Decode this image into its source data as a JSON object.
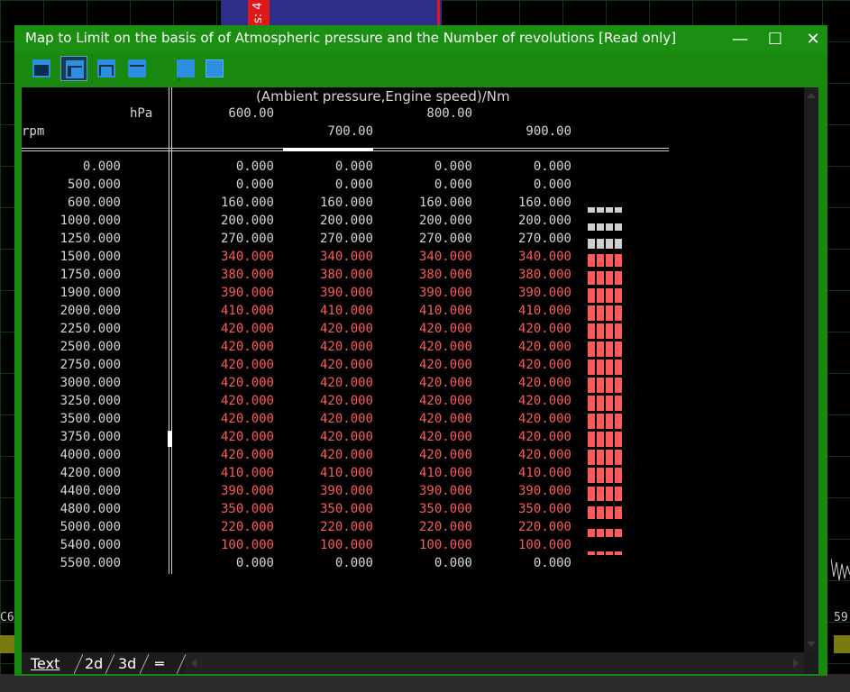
{
  "window": {
    "title": "Map to Limit on the basis of of Atmospheric pressure and the Number of revolutions   [Read only]",
    "minimize_glyph": "—",
    "maximize_glyph": "☐",
    "close_glyph": "✕"
  },
  "background": {
    "band_label": "s: 4",
    "left_label": "C6",
    "right_label": "59"
  },
  "toolbar": {
    "buttons": [
      "layout-1-icon",
      "layout-2-icon",
      "layout-3-icon",
      "layout-4-icon",
      "grid-select-icon",
      "solid-square-icon"
    ]
  },
  "table": {
    "title": "(Ambient pressure,Engine speed)/Nm",
    "x_unit": "hPa",
    "y_unit": "rpm",
    "columns_upper": [
      "600.00",
      "800.00"
    ],
    "columns_lower": [
      "700.00",
      "900.00"
    ],
    "rows": [
      {
        "rpm": "0.000",
        "v": [
          "0.000",
          "0.000",
          "0.000",
          "0.000"
        ],
        "red": false,
        "level": 0
      },
      {
        "rpm": "500.000",
        "v": [
          "0.000",
          "0.000",
          "0.000",
          "0.000"
        ],
        "red": false,
        "level": 0
      },
      {
        "rpm": "600.000",
        "v": [
          "160.000",
          "160.000",
          "160.000",
          "160.000"
        ],
        "red": false,
        "level": 0.38
      },
      {
        "rpm": "1000.000",
        "v": [
          "200.000",
          "200.000",
          "200.000",
          "200.000"
        ],
        "red": false,
        "level": 0.48
      },
      {
        "rpm": "1250.000",
        "v": [
          "270.000",
          "270.000",
          "270.000",
          "270.000"
        ],
        "red": false,
        "level": 0.64
      },
      {
        "rpm": "1500.000",
        "v": [
          "340.000",
          "340.000",
          "340.000",
          "340.000"
        ],
        "red": true,
        "level": 0.81
      },
      {
        "rpm": "1750.000",
        "v": [
          "380.000",
          "380.000",
          "380.000",
          "380.000"
        ],
        "red": true,
        "level": 0.9
      },
      {
        "rpm": "1900.000",
        "v": [
          "390.000",
          "390.000",
          "390.000",
          "390.000"
        ],
        "red": true,
        "level": 0.93
      },
      {
        "rpm": "2000.000",
        "v": [
          "410.000",
          "410.000",
          "410.000",
          "410.000"
        ],
        "red": true,
        "level": 0.98
      },
      {
        "rpm": "2250.000",
        "v": [
          "420.000",
          "420.000",
          "420.000",
          "420.000"
        ],
        "red": true,
        "level": 1.0
      },
      {
        "rpm": "2500.000",
        "v": [
          "420.000",
          "420.000",
          "420.000",
          "420.000"
        ],
        "red": true,
        "level": 1.0
      },
      {
        "rpm": "2750.000",
        "v": [
          "420.000",
          "420.000",
          "420.000",
          "420.000"
        ],
        "red": true,
        "level": 1.0
      },
      {
        "rpm": "3000.000",
        "v": [
          "420.000",
          "420.000",
          "420.000",
          "420.000"
        ],
        "red": true,
        "level": 1.0
      },
      {
        "rpm": "3250.000",
        "v": [
          "420.000",
          "420.000",
          "420.000",
          "420.000"
        ],
        "red": true,
        "level": 1.0
      },
      {
        "rpm": "3500.000",
        "v": [
          "420.000",
          "420.000",
          "420.000",
          "420.000"
        ],
        "red": true,
        "level": 1.0
      },
      {
        "rpm": "3750.000",
        "v": [
          "420.000",
          "420.000",
          "420.000",
          "420.000"
        ],
        "red": true,
        "level": 1.0
      },
      {
        "rpm": "4000.000",
        "v": [
          "420.000",
          "420.000",
          "420.000",
          "420.000"
        ],
        "red": true,
        "level": 1.0
      },
      {
        "rpm": "4200.000",
        "v": [
          "410.000",
          "410.000",
          "410.000",
          "410.000"
        ],
        "red": true,
        "level": 0.98
      },
      {
        "rpm": "4400.000",
        "v": [
          "390.000",
          "390.000",
          "390.000",
          "390.000"
        ],
        "red": true,
        "level": 0.93
      },
      {
        "rpm": "4800.000",
        "v": [
          "350.000",
          "350.000",
          "350.000",
          "350.000"
        ],
        "red": true,
        "level": 0.83
      },
      {
        "rpm": "5000.000",
        "v": [
          "220.000",
          "220.000",
          "220.000",
          "220.000"
        ],
        "red": true,
        "level": 0.52
      },
      {
        "rpm": "5400.000",
        "v": [
          "100.000",
          "100.000",
          "100.000",
          "100.000"
        ],
        "red": true,
        "level": 0.24
      },
      {
        "rpm": "5500.000",
        "v": [
          "0.000",
          "0.000",
          "0.000",
          "0.000"
        ],
        "red": false,
        "level": 0
      }
    ]
  },
  "tabs": [
    {
      "label": "Text",
      "active": true
    },
    {
      "label": "2d",
      "active": false
    },
    {
      "label": "3d",
      "active": false
    },
    {
      "label": "═",
      "active": false
    }
  ],
  "colors": {
    "window_green": "#1a8f12",
    "red_value": "#ff5a5a",
    "gray_bar": "#cfcfcf",
    "red_bar": "#ff5a5a"
  }
}
